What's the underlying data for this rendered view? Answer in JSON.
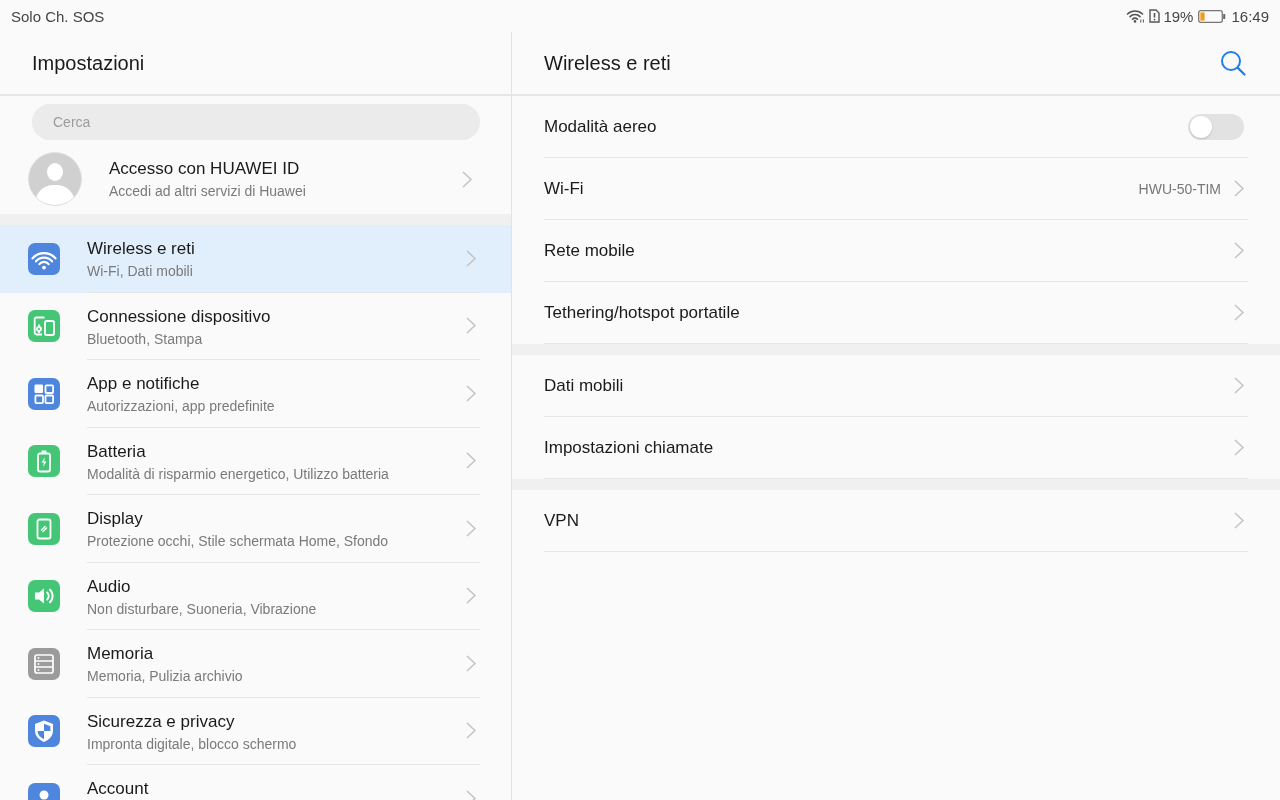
{
  "status_bar": {
    "carrier": "Solo Ch. SOS",
    "battery_percent": "19%",
    "time": "16:49"
  },
  "sidebar": {
    "title": "Impostazioni",
    "search": {
      "placeholder": "Cerca"
    },
    "account": {
      "title": "Accesso con HUAWEI ID",
      "subtitle": "Accedi ad altri servizi di Huawei"
    },
    "items": [
      {
        "kind": "wifi",
        "color": "#4f86dd",
        "title": "Wireless e reti",
        "subtitle": "Wi-Fi, Dati mobili",
        "selected": true
      },
      {
        "kind": "devices",
        "color": "#45c677",
        "title": "Connessione dispositivo",
        "subtitle": "Bluetooth, Stampa",
        "selected": false
      },
      {
        "kind": "apps",
        "color": "#4f86dd",
        "title": "App e notifiche",
        "subtitle": "Autorizzazioni, app predefinite",
        "selected": false
      },
      {
        "kind": "battery",
        "color": "#45c677",
        "title": "Batteria",
        "subtitle": "Modalità di risparmio energetico, Utilizzo batteria",
        "selected": false
      },
      {
        "kind": "display",
        "color": "#45c677",
        "title": "Display",
        "subtitle": "Protezione occhi, Stile schermata Home, Sfondo",
        "selected": false
      },
      {
        "kind": "sound",
        "color": "#45c677",
        "title": "Audio",
        "subtitle": "Non disturbare, Suoneria, Vibrazione",
        "selected": false
      },
      {
        "kind": "storage",
        "color": "#9b9b9b",
        "title": "Memoria",
        "subtitle": "Memoria, Pulizia archivio",
        "selected": false
      },
      {
        "kind": "security",
        "color": "#4f86dd",
        "title": "Sicurezza e privacy",
        "subtitle": "Impronta digitale, blocco schermo",
        "selected": false
      },
      {
        "kind": "account",
        "color": "#4f86dd",
        "title": "Account",
        "selected": false
      }
    ]
  },
  "detail": {
    "title": "Wireless e reti",
    "groups": [
      {
        "rows": [
          {
            "kind": "toggle",
            "label": "Modalità aereo",
            "on": false
          },
          {
            "kind": "link",
            "label": "Wi-Fi",
            "value": "HWU-50-TIM"
          },
          {
            "kind": "link",
            "label": "Rete mobile"
          },
          {
            "kind": "link",
            "label": "Tethering/hotspot portatile"
          }
        ]
      },
      {
        "rows": [
          {
            "kind": "link",
            "label": "Dati mobili"
          },
          {
            "kind": "link",
            "label": "Impostazioni chiamate"
          }
        ]
      },
      {
        "rows": [
          {
            "kind": "link",
            "label": "VPN"
          }
        ]
      }
    ]
  }
}
